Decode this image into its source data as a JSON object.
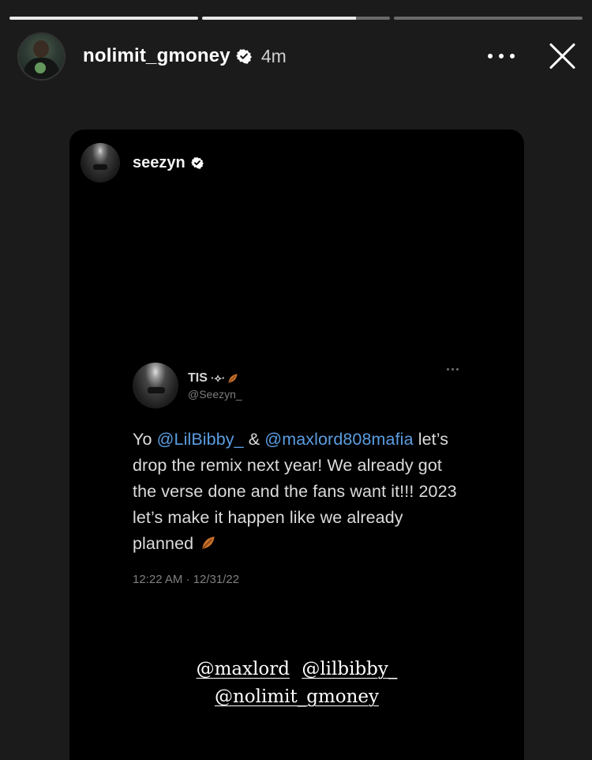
{
  "progress": [
    1.0,
    0.82,
    0.0
  ],
  "header": {
    "username": "nolimit_gmoney",
    "time": "4m",
    "icons": {
      "more": "more-horizontal-icon",
      "close": "close-icon",
      "verified": "verified-badge-icon"
    }
  },
  "card": {
    "username": "seezyn",
    "icons": {
      "verified": "verified-badge-icon"
    }
  },
  "tweet": {
    "name": "TIS",
    "symbols": "·⟡·",
    "handle": "@Seezyn_",
    "text": {
      "prefix": "Yo ",
      "mention1": "@LilBibby_",
      "and": " & ",
      "mention2": "@maxlord808mafia",
      "rest": " let’s drop the remix next year! We already got the verse done and the fans want it!!! 2023 let’s make it happen like we already planned "
    },
    "meta": "12:22 AM · 12/31/22"
  },
  "tags": {
    "line1": [
      "@maxlord",
      "@lilbibby_"
    ],
    "line2": [
      "@nolimit_gmoney"
    ]
  },
  "colors": {
    "background": "#1b1b1b",
    "card": "#000000",
    "mention": "#5b9de0",
    "leaf": "#c8712b"
  }
}
